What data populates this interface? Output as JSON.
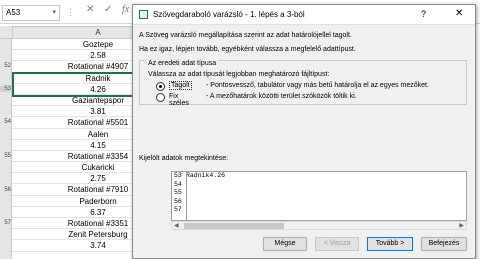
{
  "formula_bar": {
    "name_box": "A53",
    "input_value": "Ra",
    "icons": [
      "more-options-icon",
      "cancel-icon",
      "confirm-icon",
      "function-icon"
    ]
  },
  "sheet": {
    "column_header": "A",
    "rows": [
      {
        "num": "",
        "value": "Goztepe"
      },
      {
        "num": "",
        "value": "2.58"
      },
      {
        "num": "52",
        "value": "Rotational #4907"
      },
      {
        "num": "",
        "value": "Radnik"
      },
      {
        "num": "53",
        "value": "4.26"
      },
      {
        "num": "",
        "value": "Gaziantepspor"
      },
      {
        "num": "",
        "value": "3.81"
      },
      {
        "num": "54",
        "value": "Rotational #5501"
      },
      {
        "num": "",
        "value": "Aalen"
      },
      {
        "num": "",
        "value": "4.15"
      },
      {
        "num": "55",
        "value": "Rotational #3354"
      },
      {
        "num": "",
        "value": "Cukaricki"
      },
      {
        "num": "",
        "value": "2.75"
      },
      {
        "num": "56",
        "value": "Rotational #7910"
      },
      {
        "num": "",
        "value": "Paderborn"
      },
      {
        "num": "",
        "value": "6.37"
      },
      {
        "num": "57",
        "value": "Rotational #3351"
      },
      {
        "num": "",
        "value": "Zenit Petersburg"
      },
      {
        "num": "",
        "value": "3.74"
      }
    ]
  },
  "dialog": {
    "title": "Szövegdaraboló varázsló - 1. lépés a 3-ból",
    "help": "?",
    "close": "✕",
    "intro1": "A Szöveg varázsló megállapítása szerint az adat határolójellel tagolt.",
    "intro2": "Ha ez igaz, lépjen tovább, egyébként válassza a megfelelő adattípust.",
    "group_title": "Az eredeti adat típusa",
    "group_hint": "Válassza az adat típusát legjobban meghatározó fájltípust:",
    "option1_label": "Tagolt",
    "option1_desc": "- Pontosvessző, tabulátor vagy más betű határolja el az egyes mezőket.",
    "option2_label": "Fix széles",
    "option2_desc": "- A mezőhatárok közötti terület szóközök töltik ki.",
    "preview_label": "Kijelölt adatok megtekintése:",
    "preview_lines": [
      {
        "num": "53",
        "text": "Radnik4.26"
      },
      {
        "num": "54",
        "text": ""
      },
      {
        "num": "55",
        "text": ""
      },
      {
        "num": "56",
        "text": ""
      },
      {
        "num": "57",
        "text": ""
      }
    ],
    "buttons": {
      "cancel": "Mégse",
      "back": "< Vissza",
      "next": "Tovább >",
      "finish": "Befejezés"
    }
  }
}
